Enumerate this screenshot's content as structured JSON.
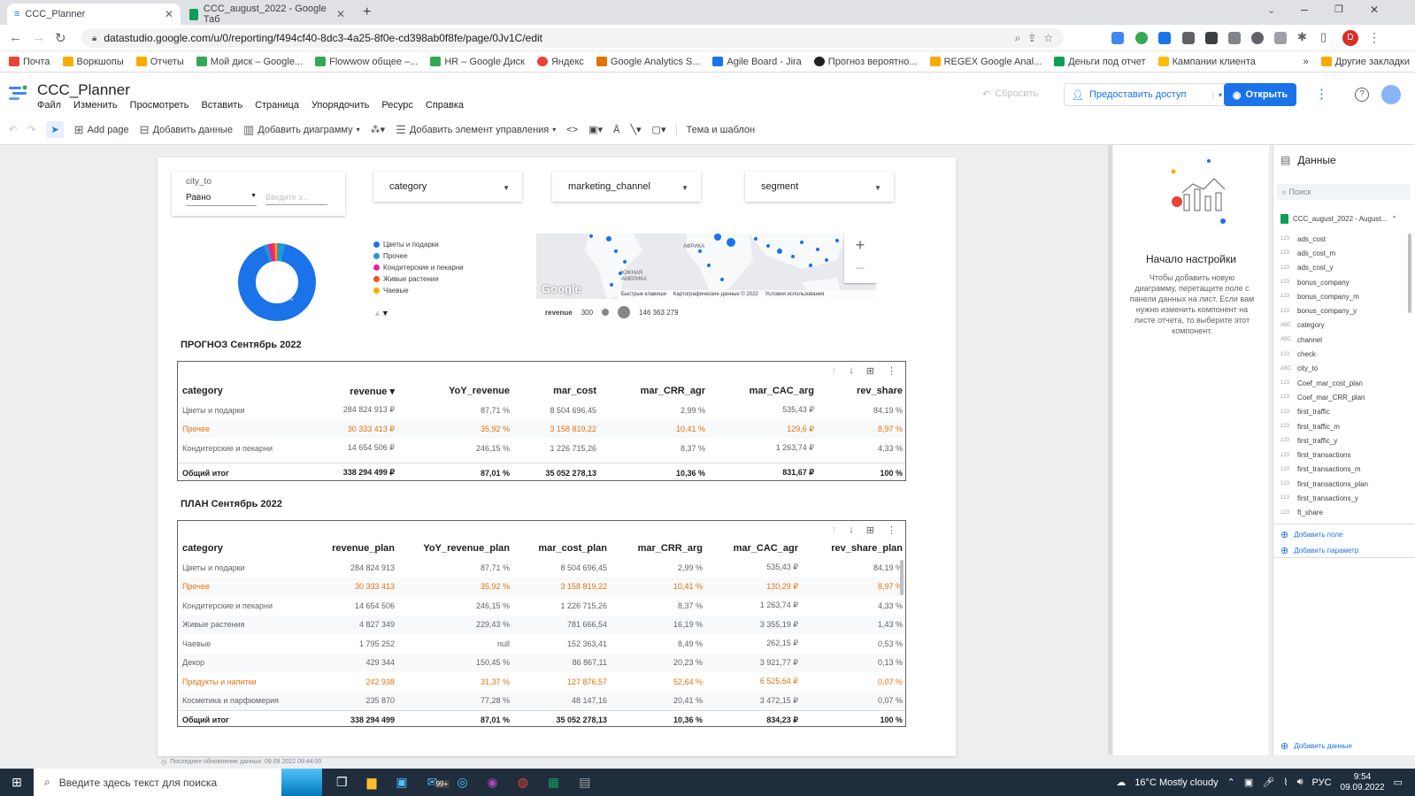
{
  "browser": {
    "tabs": [
      {
        "title": "CCC_Planner",
        "active": true
      },
      {
        "title": "CCC_august_2022 - Google Таб",
        "active": false
      }
    ],
    "url": "datastudio.google.com/u/0/reporting/f494cf40-8dc3-4a25-8f0e-cd398ab0f8fe/page/0Jv1C/edit",
    "bookmarks": [
      "Почта",
      "Воркшопы",
      "Отчеты",
      "Мой диск – Google...",
      "Flowwow общее –...",
      "HR – Google Диск",
      "Яндекс",
      "Google Analytics S...",
      "Agile Board - Jira",
      "Прогноз вероятно...",
      "REGEX Google Anal...",
      "Деньги под отчет",
      "Кампании клиента"
    ],
    "other_bookmarks": "Другие закладки",
    "more_bookmarks": "»"
  },
  "app": {
    "title": "CCC_Planner",
    "menu": [
      "Файл",
      "Изменить",
      "Просмотреть",
      "Вставить",
      "Страница",
      "Упорядочить",
      "Ресурс",
      "Справка"
    ],
    "reset_label": "Сбросить",
    "share_label": "Предоставить доступ",
    "open_label": "Открыть"
  },
  "toolbar": {
    "add_page": "Add page",
    "add_data": "Добавить данные",
    "add_chart": "Добавить диаграмму",
    "add_control": "Добавить элемент управления",
    "theme": "Тема и шаблон"
  },
  "controls": {
    "city_label": "city_to",
    "city_operator": "Равно",
    "city_placeholder": "Введите з...",
    "category": "category",
    "marketing_channel": "marketing_channel",
    "segment": "segment"
  },
  "donut": {
    "center_label": "93,2%",
    "legend": [
      {
        "label": "Цветы и подарки",
        "color": "#1a73e8"
      },
      {
        "label": "Прочее",
        "color": "#1e9bd7"
      },
      {
        "label": "Кондитерские и пекарни",
        "color": "#e52592"
      },
      {
        "label": "Живые растения",
        "color": "#f4511e"
      },
      {
        "label": "Чаевые",
        "color": "#f9ab00"
      }
    ]
  },
  "map": {
    "labels": [
      "АФРИКА",
      "ЮЖНАЯ АМЕРИКА"
    ],
    "brand": "Google",
    "footer": [
      "Быстрые клавиши",
      "Картографические данные © 2022",
      "Условия использования"
    ],
    "legend_metric": "revenue",
    "legend_min": "300",
    "legend_max": "146 363 279"
  },
  "forecast": {
    "title": "ПРОГНОЗ Сентябрь 2022",
    "columns": [
      "category",
      "revenue ▾",
      "YoY_revenue",
      "mar_cost",
      "mar_CRR_agr",
      "mar_CAC_arg",
      "rev_share"
    ],
    "rows": [
      [
        "Цветы и подарки",
        "284 824 913 ₽",
        "87,71 %",
        "8 504 696,45",
        "2,99 %",
        "535,43 ₽",
        "84,19 %"
      ],
      [
        "Прочее",
        "30 333 413 ₽",
        "35,92 %",
        "3 158 819,22",
        "10,41 %",
        "129,6 ₽",
        "8,97 %"
      ],
      [
        "Кондитерские и пекарни",
        "14 654 506 ₽",
        "246,15 %",
        "1 226 715,26",
        "8,37 %",
        "1 263,74 ₽",
        "4,33 %"
      ]
    ],
    "total": [
      "Общий итог",
      "338 294 499 ₽",
      "87,01 %",
      "35 052 278,13",
      "10,36 %",
      "831,67 ₽",
      "100 %"
    ]
  },
  "plan": {
    "title": "ПЛАН Сентябрь 2022",
    "columns": [
      "category",
      "revenue_plan",
      "YoY_revenue_plan",
      "mar_cost_plan",
      "mar_CRR_arg",
      "mar_CAC_agr",
      "rev_share_plan"
    ],
    "rows": [
      [
        "Цветы и подарки",
        "284 824 913",
        "87,71 %",
        "8 504 696,45",
        "2,99 %",
        "535,43 ₽",
        "84,19 %"
      ],
      [
        "Прочее",
        "30 333 413",
        "35,92 %",
        "3 158 819,22",
        "10,41 %",
        "130,29 ₽",
        "8,97 %"
      ],
      [
        "Кондитерские и пекарни",
        "14 654 506",
        "246,15 %",
        "1 226 715,26",
        "8,37 %",
        "1 263,74 ₽",
        "4,33 %"
      ],
      [
        "Живые растения",
        "4 827 349",
        "229,43 %",
        "781 666,54",
        "16,19 %",
        "3 355,19 ₽",
        "1,43 %"
      ],
      [
        "Чаевые",
        "1 795 252",
        "null",
        "152 363,41",
        "8,49 %",
        "262,15 ₽",
        "0,53 %"
      ],
      [
        "Декор",
        "429 344",
        "150,45 %",
        "86 867,11",
        "20,23 %",
        "3 921,77 ₽",
        "0,13 %"
      ],
      [
        "Продукты и напитки",
        "242 938",
        "31,37 %",
        "127 876,57",
        "52,64 %",
        "6 525,64 ₽",
        "0,07 %"
      ],
      [
        "Косметика и парфюмерия",
        "235 870",
        "77,28 %",
        "48 147,16",
        "20,41 %",
        "3 472,15 ₽",
        "0,07 %"
      ]
    ],
    "total": [
      "Общий итог",
      "338 294 499",
      "87,01 %",
      "35 052 278,13",
      "10,36 %",
      "834,23 ₽",
      "100 %"
    ]
  },
  "footer_note": "Последнее обновление данных: 09.09.2022 09:44:00",
  "setup_panel": {
    "title": "Начало настройки",
    "text": "Чтобы добавить новую диаграмму, перетащите поле с панели данных на лист. Если вам нужно изменить компонент на листе отчета, то выберите этот компонент."
  },
  "data_panel": {
    "title": "Данные",
    "search_placeholder": "Поиск",
    "source": "CCC_august_2022 - August...",
    "fields": [
      {
        "type": "123",
        "name": "ads_cost"
      },
      {
        "type": "123",
        "name": "ads_cost_m"
      },
      {
        "type": "123",
        "name": "ads_cost_y"
      },
      {
        "type": "123",
        "name": "bonus_company"
      },
      {
        "type": "123",
        "name": "bonus_company_m"
      },
      {
        "type": "123",
        "name": "bonus_company_y"
      },
      {
        "type": "ABC",
        "name": "category"
      },
      {
        "type": "ABC",
        "name": "channel"
      },
      {
        "type": "123",
        "name": "check"
      },
      {
        "type": "ABC",
        "name": "city_to"
      },
      {
        "type": "123",
        "name": "Coef_mar_cost_plan"
      },
      {
        "type": "123",
        "name": "Coef_mar_CRR_plan"
      },
      {
        "type": "123",
        "name": "first_traffic"
      },
      {
        "type": "123",
        "name": "first_traffic_m"
      },
      {
        "type": "123",
        "name": "first_traffic_y"
      },
      {
        "type": "123",
        "name": "first_transactions"
      },
      {
        "type": "123",
        "name": "first_transactions_m"
      },
      {
        "type": "123",
        "name": "first_transactions_plan"
      },
      {
        "type": "123",
        "name": "first_transactions_y"
      },
      {
        "type": "123",
        "name": "ft_share"
      }
    ],
    "add_field": "Добавить поле",
    "add_param": "Добавить параметр",
    "add_data": "Добавить данные"
  },
  "taskbar": {
    "search_placeholder": "Введите здесь текст для поиска",
    "weather": "16°C  Mostly cloudy",
    "lang": "РУС",
    "time": "9:54",
    "date": "09.09.2022",
    "mail_badge": "99+"
  }
}
